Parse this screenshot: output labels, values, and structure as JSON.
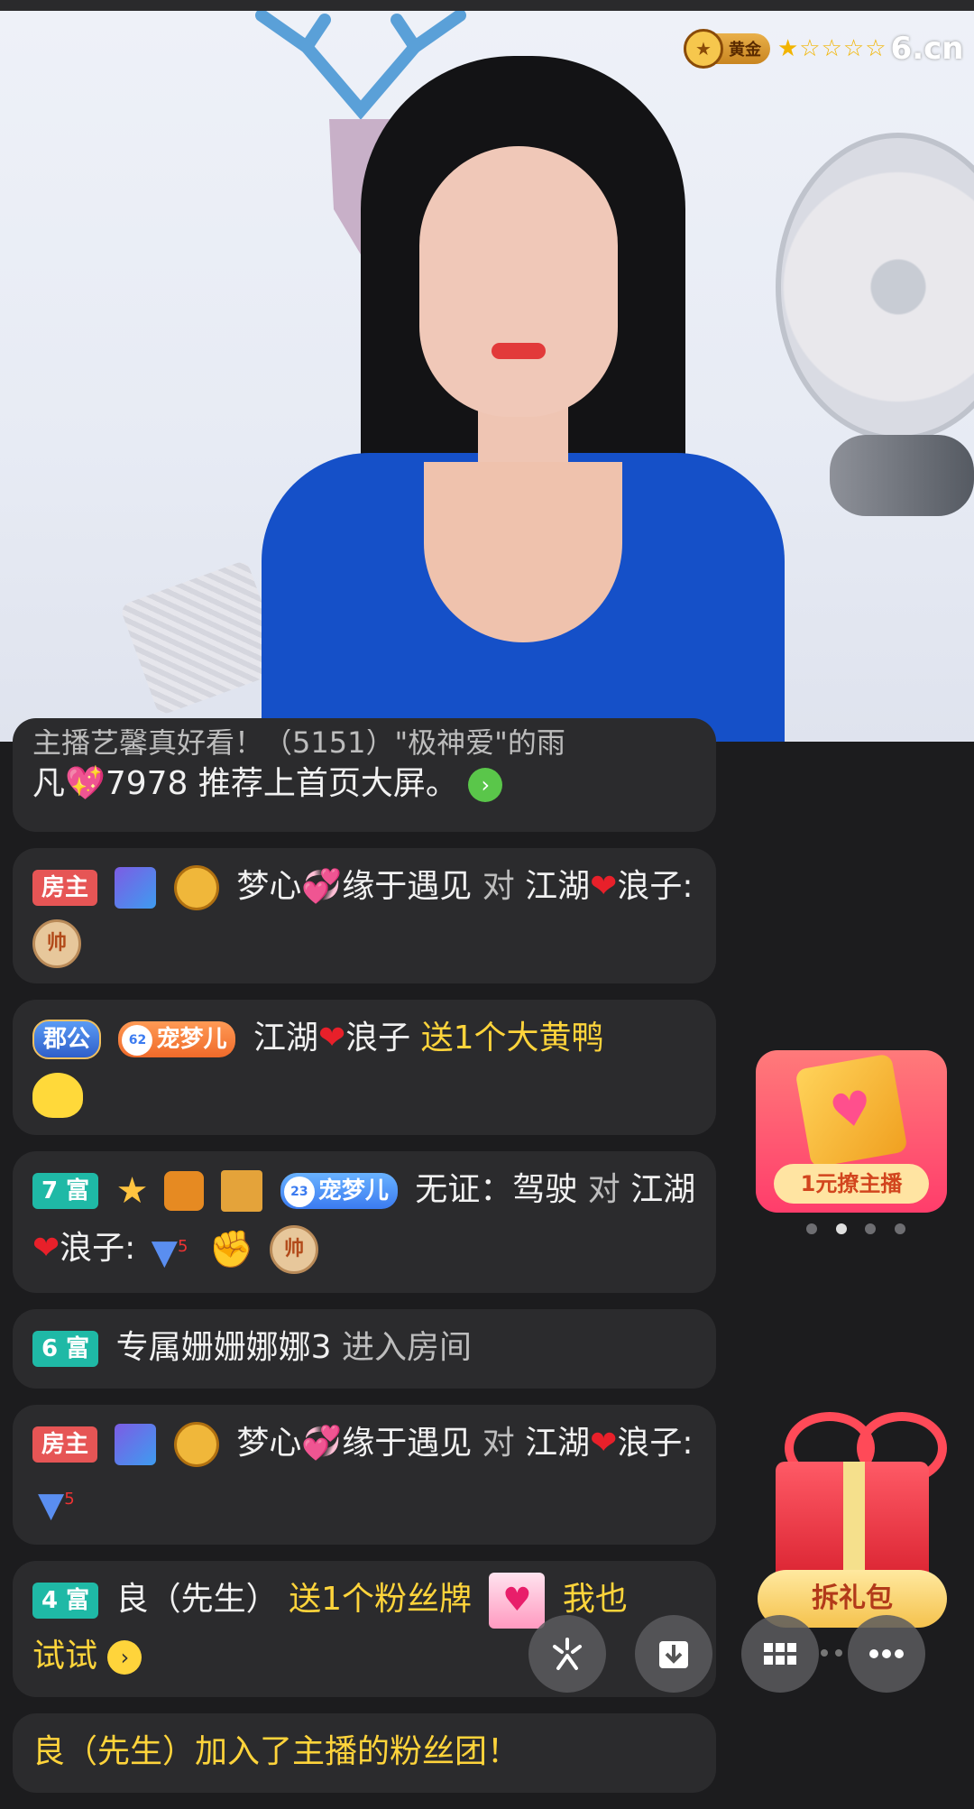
{
  "header": {
    "level_badge": "黄金",
    "stars": "★☆☆☆☆",
    "brand": "6.cn"
  },
  "chat": {
    "partial_top_line": "主播艺馨真好看！（5151）\"极神爱\"的雨",
    "messages": [
      {
        "text_a": "凡",
        "text_b": "7978 推荐上首页大屏。"
      },
      {
        "badge": "房主",
        "sender": "梦心",
        "sender2": "缘于遇见",
        "verb": "对",
        "target": "江湖",
        "target2": "浪子:",
        "chess": "帅"
      },
      {
        "badge": "郡公",
        "fan_badge": "宠梦儿",
        "fan_level": "62",
        "sender": "江湖",
        "sender2": "浪子",
        "action": "送1个大黄鸭"
      },
      {
        "badge": "7 富",
        "fan_badge": "宠梦儿",
        "fan_level": "23",
        "sender": "无证：驾驶",
        "verb": "对",
        "target": "江湖",
        "target2": "浪子:",
        "v_level": "5",
        "chess": "帅"
      },
      {
        "badge": "6 富",
        "sender": "专属姗姗娜娜3",
        "action": "进入房间"
      },
      {
        "badge": "房主",
        "sender": "梦心",
        "sender2": "缘于遇见",
        "verb": "对",
        "target": "江湖",
        "target2": "浪子:",
        "v_level": "5"
      },
      {
        "badge": "4 富",
        "sender": "良（先生）",
        "action": "送1个粉丝牌",
        "action2": "我也",
        "action3": "试试"
      },
      {
        "text": "良（先生）加入了主播的粉丝团！"
      }
    ]
  },
  "promo": {
    "label": "1元撩主播",
    "dots_count": 4,
    "active_dot": 2
  },
  "gift": {
    "label": "拆礼包"
  },
  "toolbar": {
    "icons": [
      "share-icon",
      "download-icon",
      "grid-icon",
      "more-icon"
    ]
  },
  "colors": {
    "background": "#1c1c1e",
    "bubble": "#2b2b2d",
    "highlight_yellow": "#ffd43b",
    "rich_badge": "#1fb9a6",
    "owner_badge": "#e65555"
  }
}
